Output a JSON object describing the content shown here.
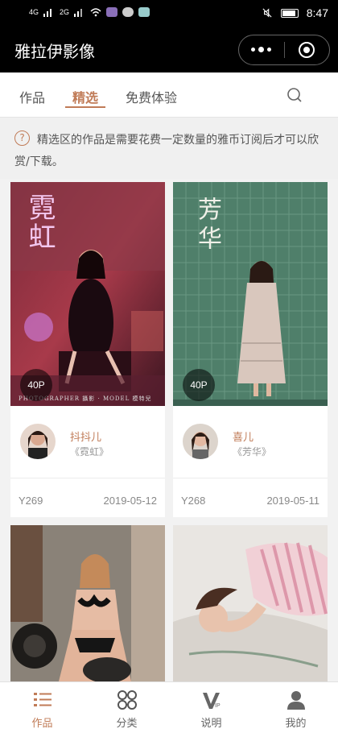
{
  "statusbar": {
    "time": "8:47",
    "signal1": "4G",
    "signal2": "2G"
  },
  "header": {
    "title": "雅拉伊影像"
  },
  "tabs": [
    {
      "label": "作品"
    },
    {
      "label": "精选"
    },
    {
      "label": "免费体验"
    }
  ],
  "notice": {
    "icon": "?",
    "text": "精选区的作品是需要花费一定数量的雅币订阅后才可以欣赏/下载。"
  },
  "cards": [
    {
      "count": "40P",
      "author": "抖抖儿",
      "title": "《霓虹》",
      "code": "Y269",
      "date": "2019-05-12",
      "overlay": "霓虹",
      "caption": "PHOTOGRAPHER 攝影 · MODEL 模特兒"
    },
    {
      "count": "40P",
      "author": "喜儿",
      "title": "《芳华》",
      "code": "Y268",
      "date": "2019-05-11",
      "overlay": "芳华"
    },
    {
      "count": "",
      "author": "",
      "title": "",
      "code": "",
      "date": ""
    },
    {
      "count": "",
      "author": "",
      "title": "",
      "code": "",
      "date": ""
    }
  ],
  "bottomnav": [
    {
      "label": "作品",
      "icon": "list-icon",
      "active": true
    },
    {
      "label": "分类",
      "icon": "grid-icon",
      "active": false
    },
    {
      "label": "说明",
      "icon": "vip-icon",
      "active": false
    },
    {
      "label": "我的",
      "icon": "user-icon",
      "active": false
    }
  ],
  "colors": {
    "accent": "#c07b57",
    "topbar": "#000000",
    "background": "#f2f2f2"
  }
}
